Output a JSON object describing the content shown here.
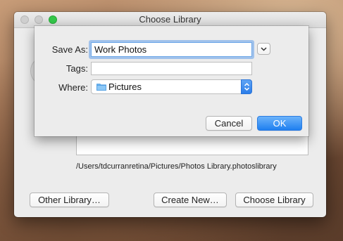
{
  "window": {
    "title": "Choose Library",
    "library_path": "/Users/tdcurranretina/Pictures/Photos Library.photoslibrary",
    "buttons": {
      "other_library": "Other Library…",
      "create_new": "Create New…",
      "choose_library": "Choose Library"
    }
  },
  "sheet": {
    "save_as_label": "Save As:",
    "save_as_value": "Work Photos",
    "tags_label": "Tags:",
    "tags_value": "",
    "where_label": "Where:",
    "where_value": "Pictures",
    "cancel_label": "Cancel",
    "ok_label": "OK"
  },
  "colors": {
    "accent": "#2a7de9",
    "zoom_button": "#34c84a"
  },
  "icons": [
    "chevron-down-icon",
    "folder-icon",
    "up-down-chevron-icon"
  ]
}
